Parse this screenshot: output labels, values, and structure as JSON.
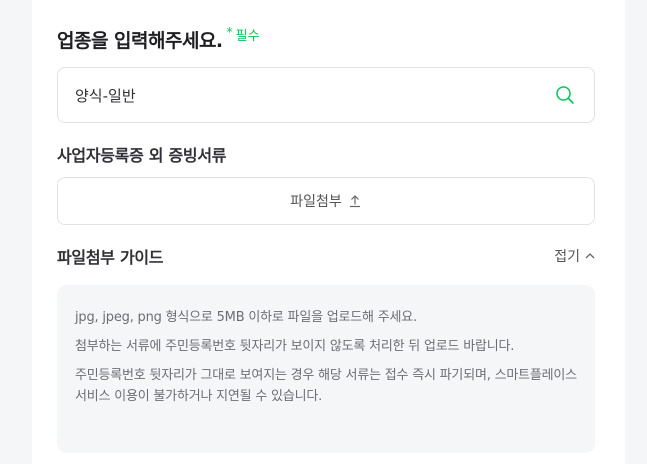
{
  "header": {
    "title": "업종을 입력해주세요.",
    "required_star": "*",
    "required_label": "필수"
  },
  "search": {
    "value": "양식-일반",
    "icon": "search-icon"
  },
  "documents": {
    "title": "사업자등록증 외 증빙서류",
    "attach_label": "파일첨부",
    "attach_icon": "upload-icon"
  },
  "guide": {
    "title": "파일첨부 가이드",
    "fold_label": "접기",
    "fold_icon": "chevron-up-icon",
    "lines": [
      "jpg, jpeg, png 형식으로 5MB 이하로 파일을 업로드해 주세요.",
      "첨부하는 서류에 주민등록번호 뒷자리가 보이지 않도록 처리한 뒤 업로드 바랍니다.",
      "주민등록번호 뒷자리가 그대로 보여지는 경우 해당 서류는 접수 즉시 파기되며, 스마트플레이스 서비스 이용이 불가하거나 지연될 수 있습니다."
    ]
  },
  "colors": {
    "accent": "#03c75a",
    "background": "#f5f6f8",
    "border": "#e0e2e6"
  }
}
